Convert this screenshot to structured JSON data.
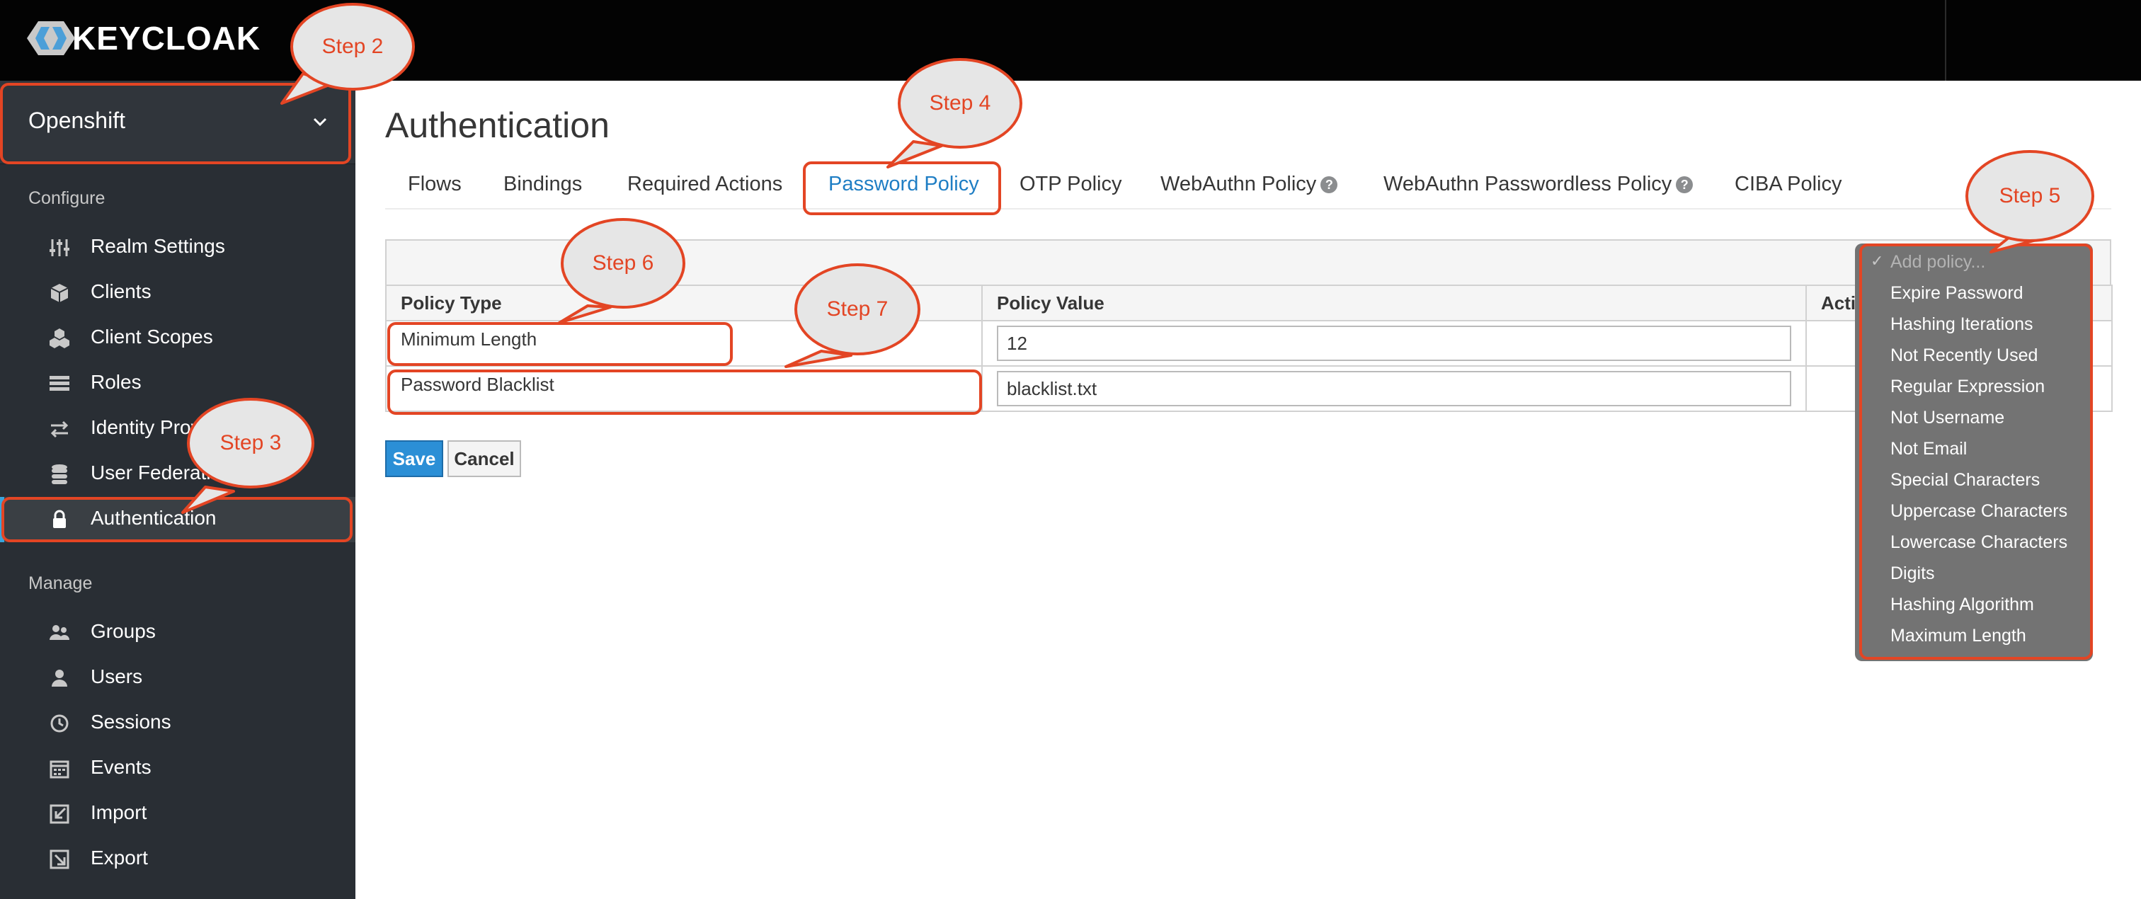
{
  "header": {
    "logo_text": "KEYCLOAK"
  },
  "sidebar": {
    "realm": "Openshift",
    "configure_label": "Configure",
    "configure_items": [
      {
        "label": "Realm Settings",
        "icon": "sliders-icon"
      },
      {
        "label": "Clients",
        "icon": "cube-icon"
      },
      {
        "label": "Client Scopes",
        "icon": "cubes-icon"
      },
      {
        "label": "Roles",
        "icon": "list-icon"
      },
      {
        "label": "Identity Providers",
        "icon": "exchange-icon"
      },
      {
        "label": "User Federation",
        "icon": "database-icon"
      },
      {
        "label": "Authentication",
        "icon": "lock-icon",
        "active": true
      }
    ],
    "manage_label": "Manage",
    "manage_items": [
      {
        "label": "Groups",
        "icon": "users-icon"
      },
      {
        "label": "Users",
        "icon": "user-icon"
      },
      {
        "label": "Sessions",
        "icon": "clock-icon"
      },
      {
        "label": "Events",
        "icon": "calendar-icon"
      },
      {
        "label": "Import",
        "icon": "import-icon"
      },
      {
        "label": "Export",
        "icon": "export-icon"
      }
    ]
  },
  "main": {
    "title": "Authentication",
    "tabs": [
      {
        "label": "Flows"
      },
      {
        "label": "Bindings"
      },
      {
        "label": "Required Actions"
      },
      {
        "label": "Password Policy",
        "active": true
      },
      {
        "label": "OTP Policy"
      },
      {
        "label": "WebAuthn Policy",
        "help": true
      },
      {
        "label": "WebAuthn Passwordless Policy",
        "help": true
      },
      {
        "label": "CIBA Policy"
      }
    ],
    "table": {
      "columns": [
        "Policy Type",
        "Policy Value",
        "Actions"
      ],
      "rows": [
        {
          "type": "Minimum Length",
          "value": "12"
        },
        {
          "type": "Password Blacklist",
          "value": "blacklist.txt"
        }
      ]
    },
    "save_label": "Save",
    "cancel_label": "Cancel"
  },
  "add_policy_dropdown": {
    "placeholder": "Add policy...",
    "options": [
      "Expire Password",
      "Hashing Iterations",
      "Not Recently Used",
      "Regular Expression",
      "Not Username",
      "Not Email",
      "Special Characters",
      "Uppercase Characters",
      "Lowercase Characters",
      "Digits",
      "Hashing Algorithm",
      "Maximum Length"
    ]
  },
  "annotations": [
    "Step 2",
    "Step 3",
    "Step 4",
    "Step 5",
    "Step 6",
    "Step 7"
  ],
  "colors": {
    "accent": "#e34524",
    "sidebar_bg": "#292e34",
    "topbar_bg": "#030303",
    "active_tab": "#1f7ec4",
    "primary_button": "#2b8fd6",
    "dropdown_bg": "#737373"
  }
}
